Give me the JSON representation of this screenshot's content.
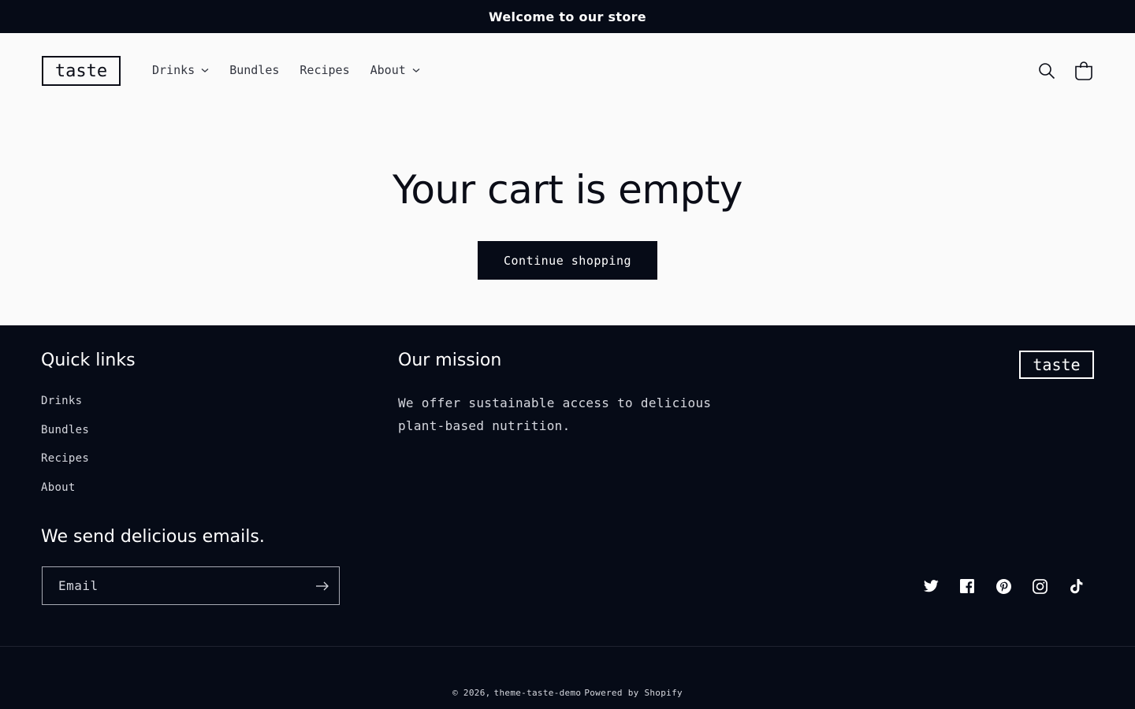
{
  "announcement": {
    "text": "Welcome to our store"
  },
  "header": {
    "logo_text": "taste",
    "nav": [
      {
        "label": "Drinks",
        "has_dropdown": true
      },
      {
        "label": "Bundles",
        "has_dropdown": false
      },
      {
        "label": "Recipes",
        "has_dropdown": false
      },
      {
        "label": "About",
        "has_dropdown": true
      }
    ],
    "icons": [
      "search-icon",
      "cart-icon"
    ]
  },
  "main": {
    "title": "Your cart is empty",
    "continue_label": "Continue shopping"
  },
  "footer": {
    "quick_links_heading": "Quick links",
    "quick_links": [
      "Drinks",
      "Bundles",
      "Recipes",
      "About"
    ],
    "mission_heading": "Our mission",
    "mission_text": "We offer sustainable access to delicious plant-based nutrition.",
    "logo_text": "taste",
    "newsletter_heading": "We send delicious emails.",
    "email_placeholder": "Email",
    "socials": [
      "twitter-icon",
      "facebook-icon",
      "pinterest-icon",
      "instagram-icon",
      "tiktok-icon"
    ],
    "copyright": {
      "year": "© 2026,",
      "store": "theme-taste-demo",
      "powered": "Powered by Shopify"
    }
  },
  "colors": {
    "dark": "#060b17",
    "background": "#fafafa",
    "text": "#0b0d17"
  }
}
